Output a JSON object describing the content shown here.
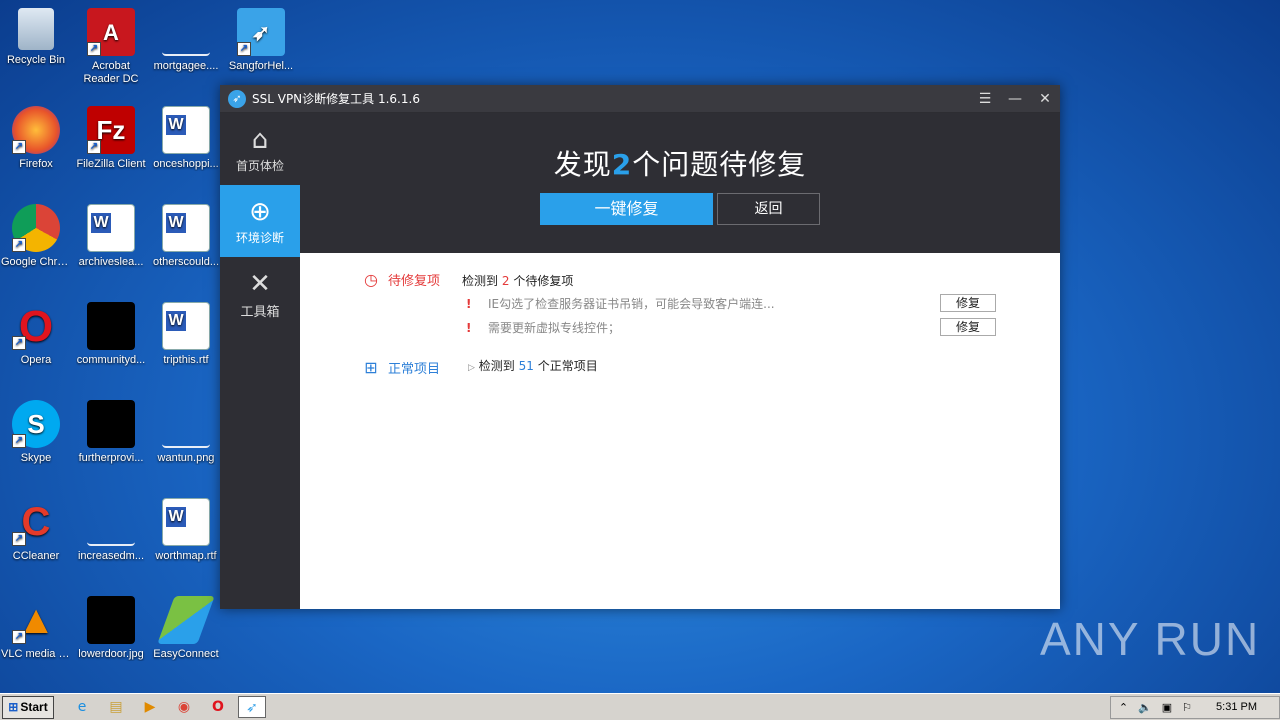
{
  "desktop_icons": [
    {
      "label": "Recycle Bin",
      "icon": "recycle-bin-icon"
    },
    {
      "label": "Acrobat Reader DC",
      "icon": "acrobat-icon"
    },
    {
      "label": "mortgagee....",
      "icon": "file-icon"
    },
    {
      "label": "SangforHel...",
      "icon": "sangfor-icon"
    },
    {
      "label": "Firefox",
      "icon": "firefox-icon"
    },
    {
      "label": "FileZilla Client",
      "icon": "filezilla-icon"
    },
    {
      "label": "onceshoppi...",
      "icon": "word-doc-icon"
    },
    {
      "label": "Google Chrome",
      "icon": "chrome-icon"
    },
    {
      "label": "archiveslea...",
      "icon": "word-doc-icon"
    },
    {
      "label": "otherscould...",
      "icon": "word-doc-icon"
    },
    {
      "label": "Opera",
      "icon": "opera-icon"
    },
    {
      "label": "communityd...",
      "icon": "image-file-icon"
    },
    {
      "label": "tripthis.rtf",
      "icon": "word-doc-icon"
    },
    {
      "label": "Skype",
      "icon": "skype-icon"
    },
    {
      "label": "furtherprovi...",
      "icon": "image-file-icon"
    },
    {
      "label": "wantun.png",
      "icon": "image-file-icon"
    },
    {
      "label": "CCleaner",
      "icon": "ccleaner-icon"
    },
    {
      "label": "increasedm...",
      "icon": "file-icon"
    },
    {
      "label": "worthmap.rtf",
      "icon": "word-doc-icon"
    },
    {
      "label": "VLC media player",
      "icon": "vlc-icon"
    },
    {
      "label": "lowerdoor.jpg",
      "icon": "image-file-icon"
    },
    {
      "label": "EasyConnect",
      "icon": "easyconnect-icon"
    }
  ],
  "window": {
    "title": "SSL VPN诊断修复工具 1.6.1.6",
    "menu_glyph": "☰",
    "minimize_glyph": "—",
    "close_glyph": "✕"
  },
  "sidebar": {
    "items": [
      {
        "label": "首页体检",
        "icon": "home-icon"
      },
      {
        "label": "环境诊断",
        "icon": "crosshair-icon"
      },
      {
        "label": "工具箱",
        "icon": "tools-icon"
      }
    ]
  },
  "header": {
    "title_prefix": "发现",
    "count": "2",
    "title_suffix": "个问题待修复",
    "fix_all_label": "一键修复",
    "back_label": "返回"
  },
  "pending": {
    "section_label": "待修复项",
    "summary_prefix": "检测到",
    "summary_count": "2",
    "summary_suffix": "个待修复项",
    "issues": [
      {
        "text": "IE勾选了检查服务器证书吊销，可能会导致客户端连...",
        "fix_label": "修复"
      },
      {
        "text": "需要更新虚拟专线控件；",
        "fix_label": "修复"
      }
    ]
  },
  "normal": {
    "section_label": "正常项目",
    "summary_prefix": "检测到",
    "summary_count": "51",
    "summary_suffix": "个正常项目"
  },
  "watermark": "ANY RUN",
  "taskbar": {
    "start_label": "Start",
    "clock": "5:31 PM"
  }
}
